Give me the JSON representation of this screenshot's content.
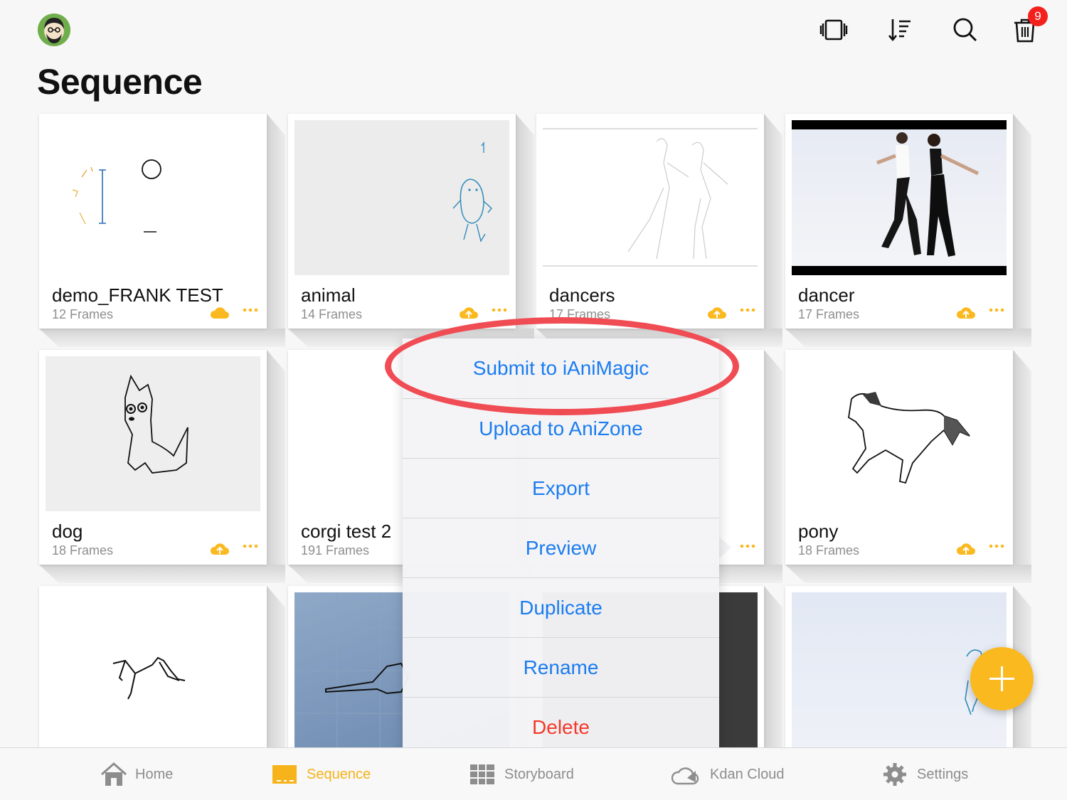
{
  "header": {
    "page_title": "Sequence",
    "trash_badge_count": "9",
    "icons": [
      "avatar",
      "frame-view-icon",
      "sort-icon",
      "search-icon",
      "trash-icon"
    ]
  },
  "projects": [
    {
      "name": "demo_FRANK TEST",
      "frames": "12 Frames"
    },
    {
      "name": "animal",
      "frames": "14 Frames"
    },
    {
      "name": "dancers",
      "frames": "17 Frames"
    },
    {
      "name": "dancer",
      "frames": "17 Frames"
    },
    {
      "name": "dog",
      "frames": "18 Frames"
    },
    {
      "name": "corgi test 2",
      "frames": "191 Frames"
    },
    {
      "name": "",
      "frames": ""
    },
    {
      "name": "pony",
      "frames": "18 Frames"
    }
  ],
  "context_menu": {
    "items": [
      {
        "label": "Submit to iAniMagic"
      },
      {
        "label": "Upload to AniZone"
      },
      {
        "label": "Export"
      },
      {
        "label": "Preview"
      },
      {
        "label": "Duplicate"
      },
      {
        "label": "Rename"
      },
      {
        "label": "Delete"
      }
    ]
  },
  "tabbar": {
    "items": [
      {
        "label": "Home"
      },
      {
        "label": "Sequence"
      },
      {
        "label": "Storyboard"
      },
      {
        "label": "Kdan Cloud"
      },
      {
        "label": "Settings"
      }
    ],
    "active": "Sequence"
  },
  "colors": {
    "accent": "#fbb920",
    "menu_text": "#1b7cf0",
    "danger": "#f4392c",
    "highlight": "#f04c54"
  }
}
